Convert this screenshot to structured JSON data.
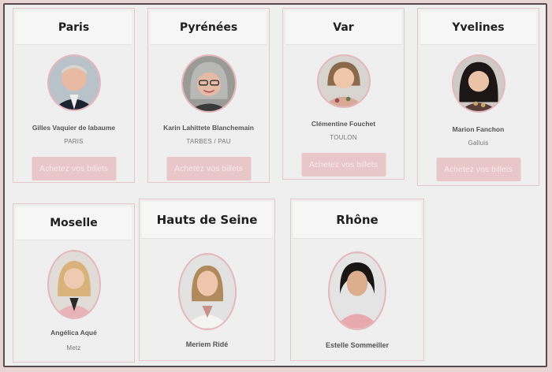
{
  "cards": [
    {
      "region": "Paris",
      "name": "Gilles Vaquier de labaume",
      "city": "PARIS",
      "button": "Achetez vos billets"
    },
    {
      "region": "Pyrénées",
      "name": "Karin Lahittete Blanchemain",
      "city": "TARBES / PAU",
      "button": "Achetez vos billets"
    },
    {
      "region": "Var",
      "name": "Clémentine Fouchet",
      "city": "TOULON",
      "button": "Achetez vos billets"
    },
    {
      "region": "Yvelines",
      "name": "Marion Fanchon",
      "city": "Galluis",
      "button": "Achetez vos billets"
    },
    {
      "region": "Moselle",
      "name": "Angélica Aqué",
      "city": "Metz"
    },
    {
      "region": "Hauts de Seine",
      "name": "Meriem Ridé"
    },
    {
      "region": "Rhône",
      "name": "Estelle Sommeiller"
    }
  ],
  "colors": {
    "accent": "#e9c6c8",
    "avatar_border": "#e5b7bc",
    "page_bg": "#e9d4d4"
  }
}
